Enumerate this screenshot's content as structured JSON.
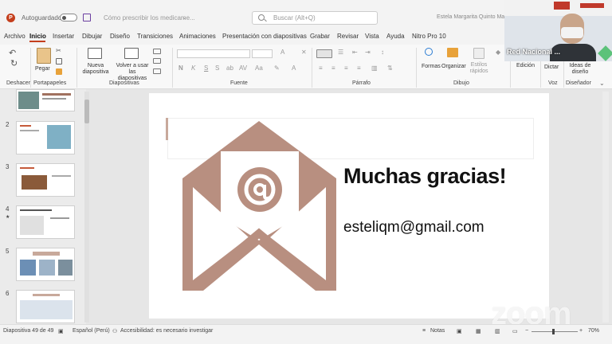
{
  "titlebar": {
    "autosave_label": "Autoguardado",
    "document_title": "Cómo prescribir los medicame...",
    "search_placeholder": "Buscar (Alt+Q)",
    "user_name": "Estela Margarita Quinto Maltz"
  },
  "menu": [
    "Archivo",
    "Inicio",
    "Insertar",
    "Dibujar",
    "Diseño",
    "Transiciones",
    "Animaciones",
    "Presentación con diapositivas",
    "Grabar",
    "Revisar",
    "Vista",
    "Ayuda",
    "Nitro Pro 10"
  ],
  "ribbon": {
    "groups": [
      "Deshacer",
      "Portapapeles",
      "Diapositivas",
      "Fuente",
      "Párrafo",
      "Dibujo",
      "Voz",
      "Diseñador"
    ],
    "buttons": {
      "paste": "Pegar",
      "new_slide": "Nueva diapositiva",
      "reuse_slides": "Volver a usar las diapositivas",
      "shapes": "Formas",
      "arrange": "Organizar",
      "quick_styles": "Estilos rápidos",
      "edit": "Edición",
      "dictate": "Dictar",
      "design_ideas": "Ideas de diseño"
    },
    "font_size_label": "A",
    "accent_color": "#c43e1c"
  },
  "thumbnails": {
    "numbers": [
      "2",
      "3",
      "4",
      "5",
      "6"
    ],
    "star_marker": "★"
  },
  "slide": {
    "title": "Muchas gracias!",
    "email": "esteliqm@gmail.com",
    "envelope_color": "#b88f80"
  },
  "status": {
    "slide_counter": "Diapositiva 49 de 49",
    "language": "Español (Perú)",
    "accessibility": "Accesibilidad: es necesario investigar",
    "notes": "Notas",
    "zoom": "70%",
    "zoom_level": 0.7
  },
  "video": {
    "participant": "Red Nacional ..."
  },
  "watermark": "zoom"
}
